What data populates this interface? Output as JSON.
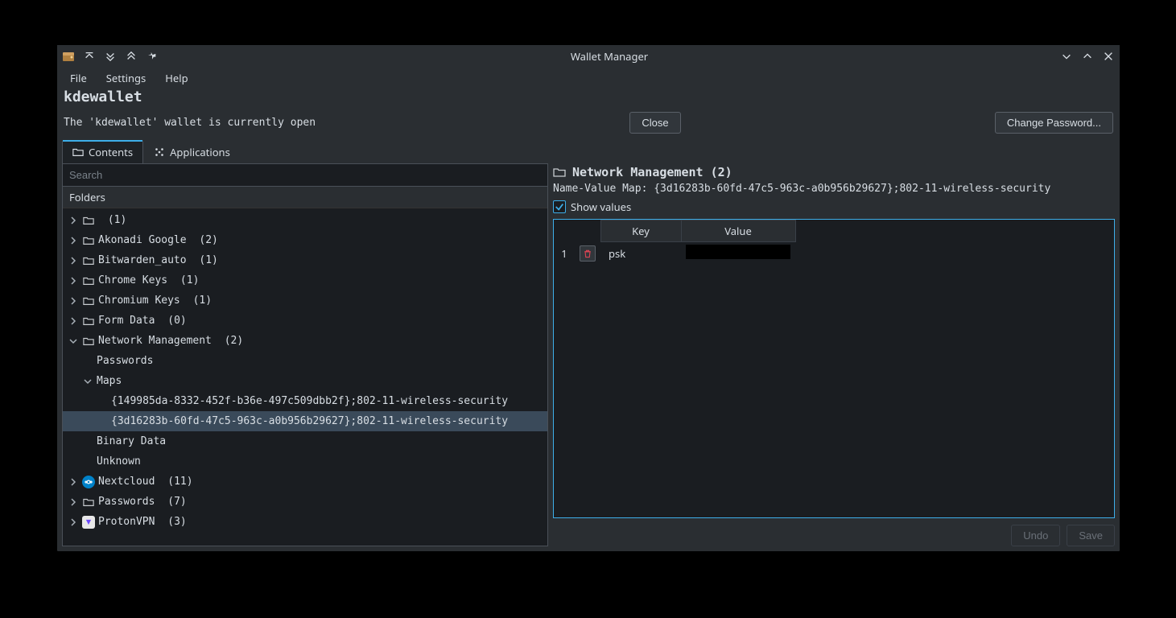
{
  "window": {
    "title": "Wallet Manager"
  },
  "menubar": {
    "file": "File",
    "settings": "Settings",
    "help": "Help"
  },
  "wallet_name": "kdewallet",
  "status_text": "The 'kdewallet' wallet is currently open",
  "buttons": {
    "close": "Close",
    "change_password": "Change Password...",
    "undo": "Undo",
    "save": "Save"
  },
  "tabs": {
    "contents": "Contents",
    "applications": "Applications"
  },
  "search_placeholder": "Search",
  "folders_header": "Folders",
  "tree": {
    "root_count": "(1)",
    "akonadi": "Akonadi Google",
    "akonadi_count": "(2)",
    "bitwarden": "Bitwarden_auto",
    "bitwarden_count": "(1)",
    "chrome": "Chrome Keys",
    "chrome_count": "(1)",
    "chromium": "Chromium Keys",
    "chromium_count": "(1)",
    "formdata": "Form Data",
    "formdata_count": "(0)",
    "network": "Network Management",
    "network_count": "(2)",
    "passwords_sub": "Passwords",
    "maps": "Maps",
    "map_item_1": "{149985da-8332-452f-b36e-497c509dbb2f};802-11-wireless-security",
    "map_item_2": "{3d16283b-60fd-47c5-963c-a0b956b29627};802-11-wireless-security",
    "binary_data": "Binary Data",
    "unknown": "Unknown",
    "nextcloud": "Nextcloud",
    "nextcloud_count": "(11)",
    "passwords": "Passwords",
    "passwords_count": "(7)",
    "protonvpn": "ProtonVPN",
    "protonvpn_count": "(3)"
  },
  "detail": {
    "title": "Network Management (2)",
    "subtitle": "Name-Value Map: {3d16283b-60fd-47c5-963c-a0b956b29627};802-11-wireless-security",
    "show_values_label": "Show values",
    "headers": {
      "key": "Key",
      "value": "Value"
    },
    "rows": [
      {
        "num": "1",
        "key": "psk",
        "value": ""
      }
    ]
  }
}
